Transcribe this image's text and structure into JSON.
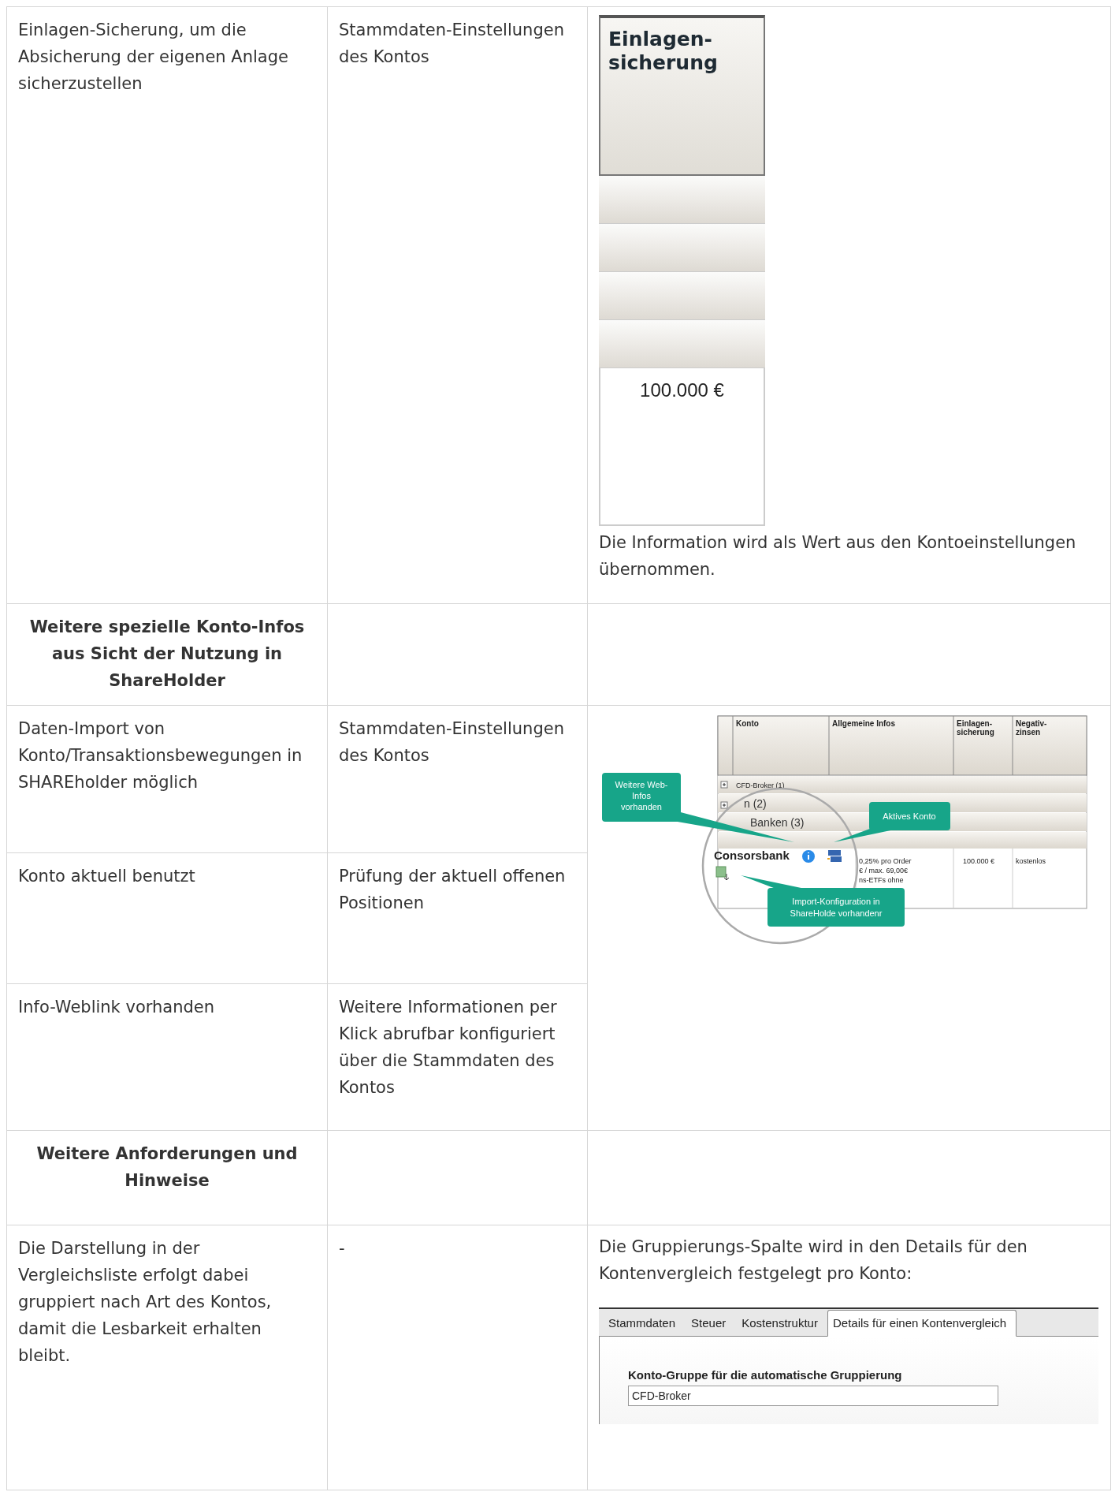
{
  "table": {
    "rows": [
      {
        "kind": "entry",
        "criterion": "Einlagen-Sicherung, um die Absicherung der eigenen Anlage sicherzustellen",
        "source": "Stammdaten-Einstellungen des Kontos",
        "detail": {
          "kind": "column_shot",
          "header": "Einlagen-sicherung",
          "value": "100.000 €",
          "caption": "Die Information wird als Wert aus den Kontoeinstellungen übernommen."
        }
      },
      {
        "kind": "section",
        "criterion": "Weitere spezielle Konto-Infos aus Sicht der Nutzung in ShareHolder"
      },
      {
        "kind": "entry",
        "criterion": "Daten-Import von Konto/Transaktionsbewegungen in SHAREholder möglich",
        "source": "Stammdaten-Einstellungen des Kontos",
        "detail": {
          "kind": "overview_shot",
          "columns": [
            "Konto",
            "Allgemeine Infos",
            "Einlagen-",
            "sicherung",
            "Negativ-",
            "zinsen"
          ],
          "groups": [
            "CFD-Broker (1)",
            "n (2)",
            "Banken (3)"
          ],
          "account": "Consorsbank",
          "info_lines": [
            "0,25% pro Order",
            "€ / max. 69,00€",
            "ns-ETFs ohne"
          ],
          "deposit": "100.000 €",
          "negative": "kostenlos",
          "callouts": [
            "Weitere Web-",
            "Infos",
            "vorhanden",
            "Aktives Konto",
            "Import-Konfiguration in",
            "ShareHolde vorhandenr"
          ]
        }
      },
      {
        "kind": "entry",
        "criterion": "Konto aktuell benutzt",
        "source": "Prüfung der aktuell offenen Positionen"
      },
      {
        "kind": "entry",
        "criterion": "Info-Weblink vorhanden",
        "source": "Weitere Informationen per Klick abrufbar konfiguriert über die Stammdaten des Kontos"
      },
      {
        "kind": "section",
        "criterion": "Weitere Anforderungen und Hinweise"
      },
      {
        "kind": "entry",
        "criterion": "Die Darstellung in der Vergleichsliste erfolgt dabei gruppiert nach Art des Kontos, damit die Lesbarkeit erhalten bleibt.",
        "source": "-",
        "detail": {
          "kind": "tabs_shot",
          "text": "Die Gruppierungs-Spalte wird in den Details für den Kontenvergleich festgelegt pro Konto:",
          "tabs": [
            {
              "label": "Stammdaten",
              "selected": false
            },
            {
              "label": "Steuer",
              "selected": false
            },
            {
              "label": "Kostenstruktur",
              "selected": false
            },
            {
              "label": "Details für einen Kontenvergleich",
              "selected": true
            }
          ],
          "field_label": "Konto-Gruppe für die automatische Gruppierung",
          "field_value": "CFD-Broker"
        }
      }
    ]
  }
}
